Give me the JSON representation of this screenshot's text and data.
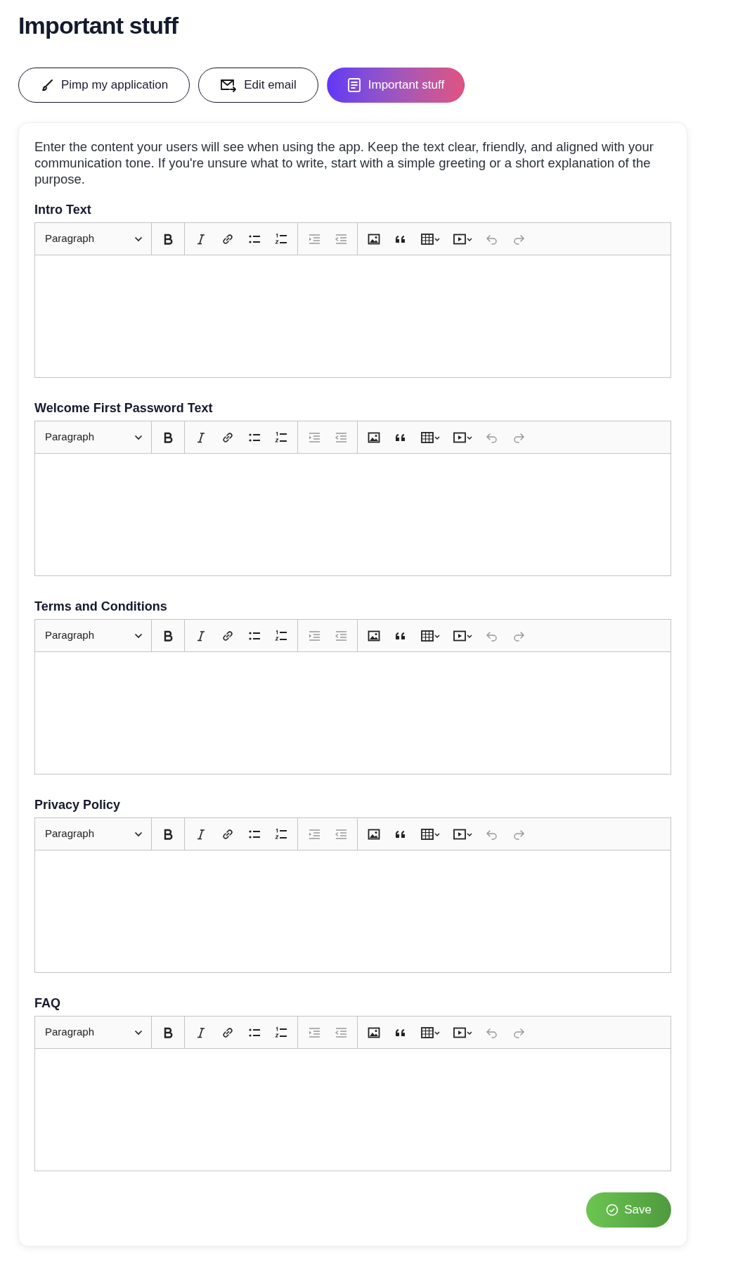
{
  "page_title": "Important stuff",
  "tabs": [
    {
      "label": "Pimp my application",
      "kind": "brush",
      "selected": false
    },
    {
      "label": "Edit email",
      "kind": "mail",
      "selected": false
    },
    {
      "label": "Important stuff",
      "kind": "doc",
      "selected": true
    }
  ],
  "intro": "Enter the content your users will see when using the app. Keep the text clear, friendly, and aligned with your communication tone. If you're unsure what to write, start with a simple greeting or a short explanation of the purpose.",
  "editors": [
    {
      "label": "Intro Text",
      "format": "Paragraph"
    },
    {
      "label": "Welcome First Password Text",
      "format": "Paragraph"
    },
    {
      "label": "Terms and Conditions",
      "format": "Paragraph"
    },
    {
      "label": "Privacy Policy",
      "format": "Paragraph"
    },
    {
      "label": "FAQ",
      "format": "Paragraph"
    }
  ],
  "save_button": "Save"
}
